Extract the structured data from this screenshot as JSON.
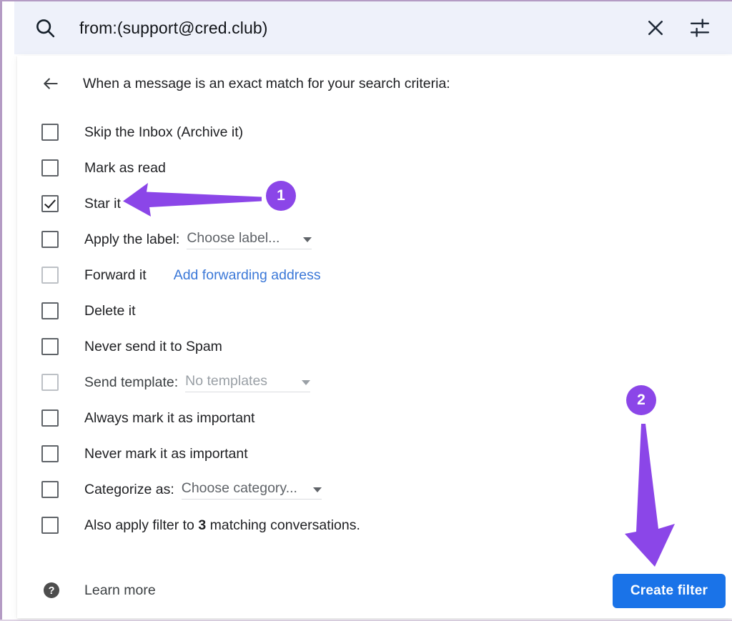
{
  "search": {
    "query": "from:(support@cred.club)",
    "icon": "search-icon",
    "clear_icon": "close-icon",
    "options_icon": "tune-sliders-icon"
  },
  "panel": {
    "back_icon": "arrow-left-icon",
    "heading": "When a message is an exact match for your search criteria:",
    "options": [
      {
        "label": "Skip the Inbox (Archive it)",
        "checked": false,
        "disabled": false
      },
      {
        "label": "Mark as read",
        "checked": false,
        "disabled": false
      },
      {
        "label": "Star it",
        "checked": true,
        "disabled": false,
        "highlighted": true
      },
      {
        "label": "Apply the label:",
        "checked": false,
        "disabled": false,
        "dropdown": "Choose label...",
        "dropdown_muted": false
      },
      {
        "label": "Forward it",
        "checked": false,
        "disabled": true,
        "link": "Add forwarding address"
      },
      {
        "label": "Delete it",
        "checked": false,
        "disabled": false
      },
      {
        "label": "Never send it to Spam",
        "checked": false,
        "disabled": false
      },
      {
        "label": "Send template:",
        "checked": false,
        "disabled": true,
        "dropdown": "No templates",
        "dropdown_muted": true
      },
      {
        "label": "Always mark it as important",
        "checked": false,
        "disabled": false
      },
      {
        "label": "Never mark it as important",
        "checked": false,
        "disabled": false
      },
      {
        "label": "Categorize as:",
        "checked": false,
        "disabled": false,
        "dropdown": "Choose category...",
        "dropdown_muted": false
      },
      {
        "label_pre": "Also apply filter to ",
        "count": "3",
        "label_post": " matching conversations.",
        "checked": false,
        "disabled": false
      }
    ],
    "footer": {
      "help_icon": "help-circle-icon",
      "learn_more": "Learn more",
      "create_filter": "Create filter"
    }
  },
  "annotations": {
    "accent_color": "#8b46e8",
    "steps": [
      {
        "number": "1",
        "points_to": "Star it"
      },
      {
        "number": "2",
        "points_to": "Create filter"
      }
    ]
  },
  "colors": {
    "search_bg": "#eef1fa",
    "primary_button": "#1a73e8",
    "link": "#3b78d8",
    "frame": "#b49bc4",
    "accent": "#8b46e8"
  }
}
